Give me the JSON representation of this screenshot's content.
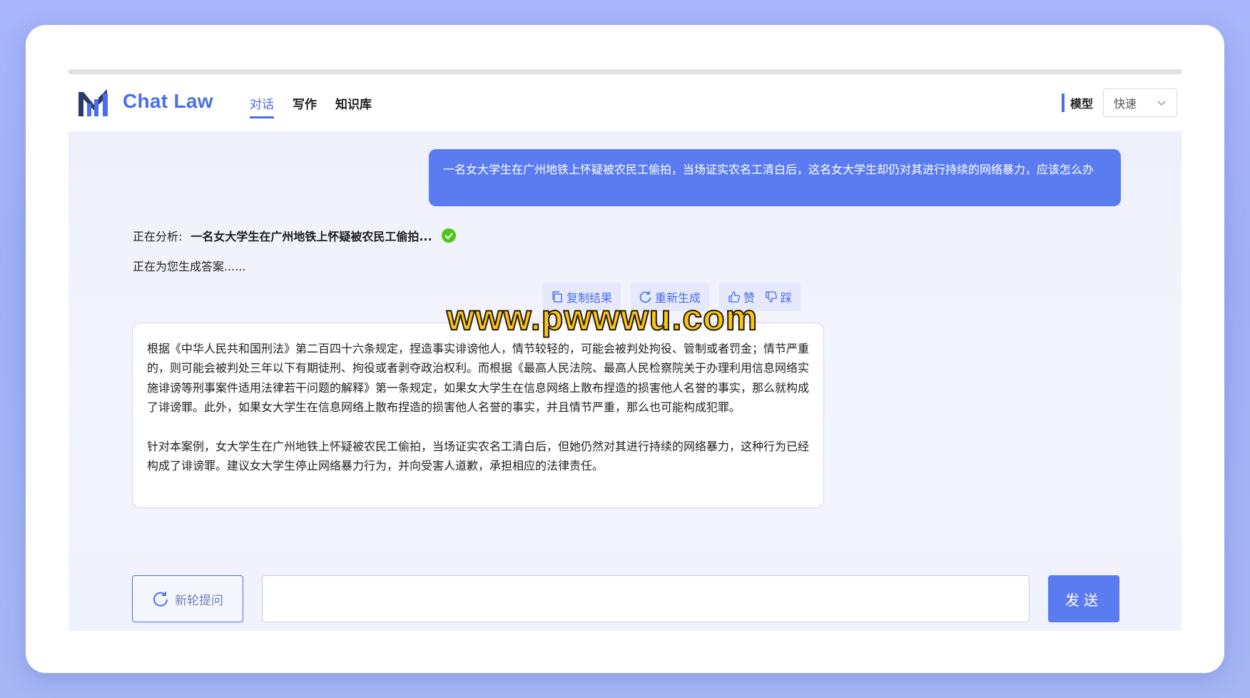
{
  "header": {
    "brand": "Chat Law",
    "tabs": [
      {
        "label": "对话",
        "active": true
      },
      {
        "label": "写作",
        "active": false
      },
      {
        "label": "知识库",
        "active": false
      }
    ],
    "model_label": "模型",
    "model_value": "快速"
  },
  "chat": {
    "user_message": "一名女大学生在广州地铁上怀疑被农民工偷拍，当场证实农名工清白后，这名女大学生却仍对其进行持续的网络暴力，应该怎么办",
    "analysis_label": "正在分析:",
    "analysis_query": "一名女大学生在广州地铁上怀疑被农民工偷拍...",
    "generating": "正在为您生成答案......",
    "actions": {
      "copy": "复制结果",
      "regenerate": "重新生成",
      "like": "赞",
      "dislike": "踩"
    },
    "answer_paragraphs": [
      "根据《中华人民共和国刑法》第二百四十六条规定，捏造事实诽谤他人，情节较轻的，可能会被判处拘役、管制或者罚金；情节严重的，则可能会被判处三年以下有期徒刑、拘役或者剥夺政治权利。而根据《最高人民法院、最高人民检察院关于办理利用信息网络实施诽谤等刑事案件适用法律若干问题的解释》第一条规定，如果女大学生在信息网络上散布捏造的损害他人名誉的事实，那么就构成了诽谤罪。此外，如果女大学生在信息网络上散布捏造的损害他人名誉的事实，并且情节严重，那么也可能构成犯罪。",
      "针对本案例，女大学生在广州地铁上怀疑被农民工偷拍，当场证实农名工清白后，但她仍然对其进行持续的网络暴力，这种行为已经构成了诽谤罪。建议女大学生停止网络暴力行为，并向受害人道歉，承担相应的法律责任。"
    ]
  },
  "watermark": "www.pwwwu.com",
  "bottom": {
    "new_question": "新轮提问",
    "input_value": "",
    "send": "发送"
  },
  "colors": {
    "accent": "#4a6ee8",
    "bubble": "#5b7cf0",
    "success": "#52c41a"
  }
}
